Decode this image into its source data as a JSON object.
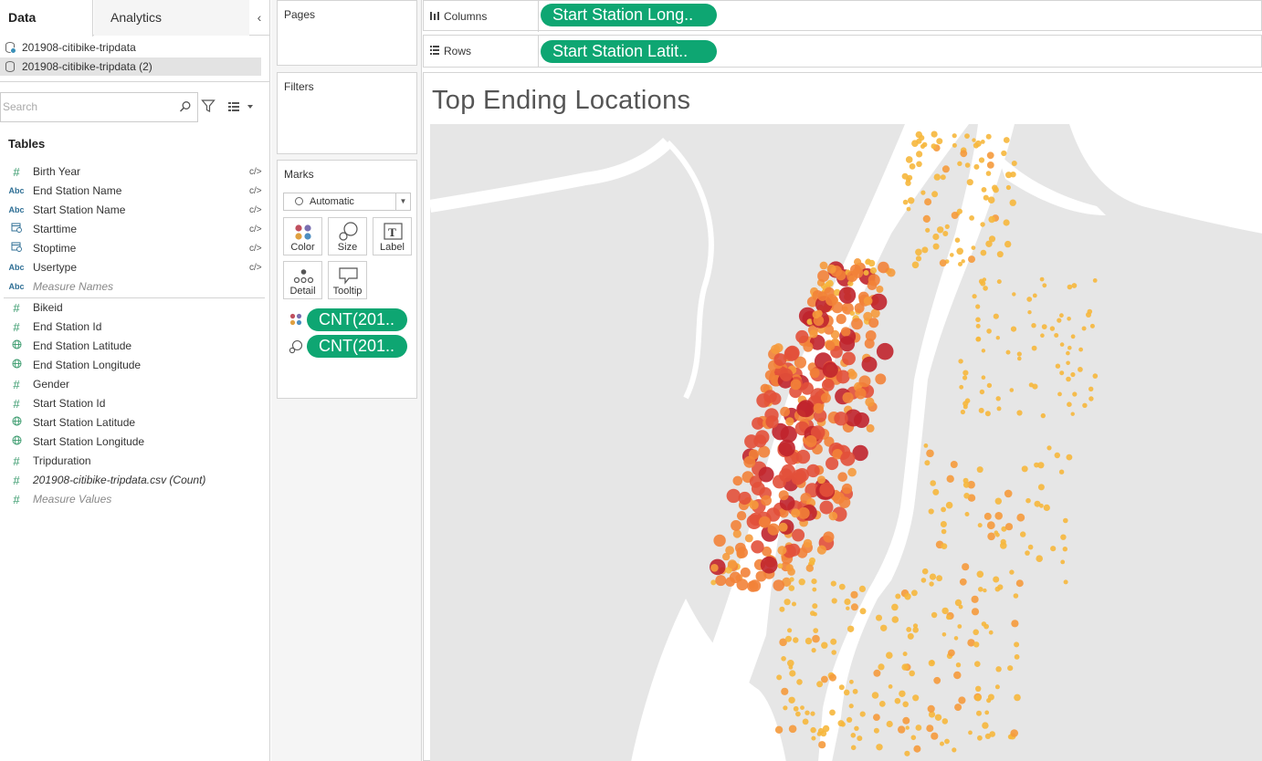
{
  "data_pane": {
    "tabs": {
      "data": "Data",
      "analytics": "Analytics"
    },
    "collapse_icon": "chevron-left-icon",
    "datasources": [
      "201908-citibike-tripdata",
      "201908-citibike-tripdata (2)"
    ],
    "search_placeholder": "Search",
    "tables_heading": "Tables",
    "dimensions": [
      {
        "type": "#",
        "name": "Birth Year",
        "meta": "c/>"
      },
      {
        "type": "Abc",
        "name": "End Station Name",
        "meta": "c/>"
      },
      {
        "type": "Abc",
        "name": "Start Station Name",
        "meta": "c/>"
      },
      {
        "type": "date",
        "name": "Starttime",
        "meta": "c/>"
      },
      {
        "type": "date",
        "name": "Stoptime",
        "meta": "c/>"
      },
      {
        "type": "Abc",
        "name": "Usertype",
        "meta": "c/>"
      },
      {
        "type": "Abc",
        "name": "Measure Names",
        "meta": ""
      }
    ],
    "measures": [
      {
        "type": "#",
        "name": "Bikeid"
      },
      {
        "type": "#",
        "name": "End Station Id"
      },
      {
        "type": "geo",
        "name": "End Station Latitude"
      },
      {
        "type": "geo",
        "name": "End Station Longitude"
      },
      {
        "type": "#",
        "name": "Gender"
      },
      {
        "type": "#",
        "name": "Start Station Id"
      },
      {
        "type": "geo",
        "name": "Start Station Latitude"
      },
      {
        "type": "geo",
        "name": "Start Station Longitude"
      },
      {
        "type": "#",
        "name": "Tripduration"
      },
      {
        "type": "#",
        "name": "201908-citibike-tripdata.csv (Count)"
      },
      {
        "type": "#",
        "name": "Measure Values"
      }
    ]
  },
  "cards": {
    "pages": "Pages",
    "filters": "Filters",
    "marks": "Marks",
    "mark_type": "Automatic",
    "buttons": {
      "color": "Color",
      "size": "Size",
      "label": "Label",
      "detail": "Detail",
      "tooltip": "Tooltip"
    },
    "label_glyph": "T",
    "mark_pills": [
      "CNT(201..",
      "CNT(201.."
    ]
  },
  "shelves": {
    "columns_label": "Columns",
    "columns_pill": "Start Station Long..",
    "rows_label": "Rows",
    "rows_pill": "Start Station Latit.."
  },
  "sheet": {
    "title": "Top Ending Locations"
  },
  "colors": {
    "pill": "#0ea672",
    "map_land": "#e6e6e6",
    "map_water": "#ffffff",
    "low": "#f6b73c",
    "mid": "#f28238",
    "high": "#c0232c"
  }
}
